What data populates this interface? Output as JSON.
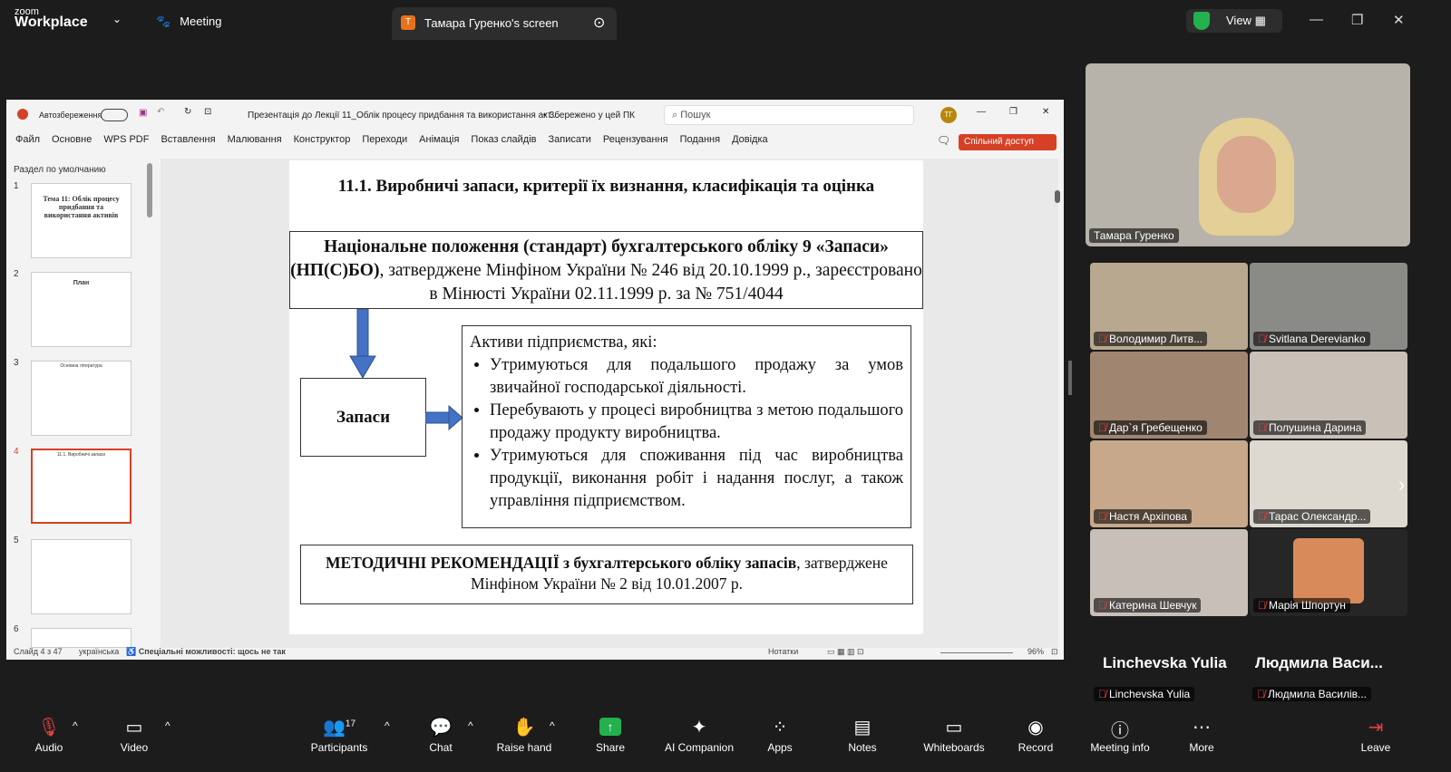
{
  "zoom": {
    "brand_top": "zoom",
    "brand_bottom": "Workplace",
    "meeting_tab": "Meeting",
    "screen_tab": "Тамара Гуренко's screen",
    "screen_tab_letter": "T",
    "view_label": "View"
  },
  "ppt": {
    "autosave": "Автозбереження",
    "doc_title": "Презентація до Лекції 11_Облік процесу придбання та використання акт...",
    "save_state": "• Збережено у цей ПК",
    "search_placeholder": "Пошук",
    "avatar": "ТГ",
    "share": "Спільний доступ",
    "menu": [
      "Файл",
      "Основне",
      "WPS PDF",
      "Вставлення",
      "Малювання",
      "Конструктор",
      "Переходи",
      "Анімація",
      "Показ слайдів",
      "Записати",
      "Рецензування",
      "Подання",
      "Довідка"
    ],
    "section": "Раздел по умолчанию",
    "thumbs": [
      {
        "n": "1",
        "text": "Тема 11: Облік процесу придбання та використання активів"
      },
      {
        "n": "2",
        "text": "План"
      },
      {
        "n": "3",
        "text": "Основна література"
      },
      {
        "n": "4",
        "text": "11.1. Виробничі запаси"
      },
      {
        "n": "5",
        "text": ""
      },
      {
        "n": "6",
        "text": ""
      }
    ],
    "status": {
      "slide": "Слайд 4 з 47",
      "lang": "українська",
      "access": "Спеціальні можливості: щось не так",
      "notes": "Нотатки",
      "zoom": "96%"
    }
  },
  "slide": {
    "title": "11.1. Виробничі запаси, критерії їх визнання, класифікація та оцінка",
    "box1_bold": "Національне положення (стандарт) бухгалтерського обліку 9 «Запаси» (НП(С)БО)",
    "box1_rest": ", затверджене Мінфіном України № 246 від 20.10.1999 р., зареєстровано в Мінюсті України 02.11.1999 р. за № 751/4044",
    "zap": "Запаси",
    "intro": "Активи підприємства, які:",
    "bullets": [
      "Утримуються для подальшого продажу за умов звичайної господарської діяльності.",
      "Перебувають у процесі виробництва з метою подальшого продажу продукту виробництва.",
      "Утримуються для споживання під час виробництва продукції, виконання робіт і надання послуг, а також управління підприємством."
    ],
    "box3_bold": "МЕТОДИЧНІ РЕКОМЕНДАЦІЇ з бухгалтерського обліку запасів",
    "box3_rest": ", затверджене Мінфіном України № 2 від 10.01.2007 р."
  },
  "participants": {
    "speaker": "Тамара Гуренко",
    "tiles": [
      "Володимир Литв...",
      "Svitlana Derevianko",
      "Дар`я Гребещенко",
      "Полушина Дарина",
      "Настя Архіпова",
      "Тарас Олександр...",
      "Катерина Шевчук",
      "Марія Шпортун"
    ],
    "nov_big": [
      "Linchevska Yulia",
      "Людмила  Васи..."
    ],
    "nov_small": [
      "Linchevska Yulia",
      "Людмила Василів..."
    ]
  },
  "toolbar": {
    "participants_count": "17",
    "items": [
      "Audio",
      "Video",
      "Participants",
      "Chat",
      "Raise hand",
      "Share",
      "AI Companion",
      "Apps",
      "Notes",
      "Whiteboards",
      "Record",
      "Meeting info",
      "More",
      "Leave"
    ]
  }
}
